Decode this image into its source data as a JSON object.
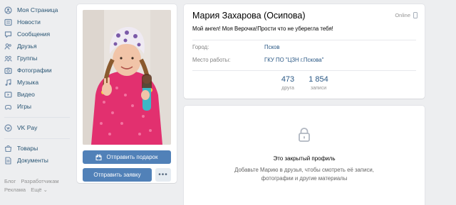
{
  "nav": {
    "items": [
      {
        "label": "Моя Страница",
        "icon": "home-icon"
      },
      {
        "label": "Новости",
        "icon": "news-icon"
      },
      {
        "label": "Сообщения",
        "icon": "messages-icon"
      },
      {
        "label": "Друзья",
        "icon": "friends-icon"
      },
      {
        "label": "Группы",
        "icon": "groups-icon"
      },
      {
        "label": "Фотографии",
        "icon": "photos-icon"
      },
      {
        "label": "Музыка",
        "icon": "music-icon"
      },
      {
        "label": "Видео",
        "icon": "video-icon"
      },
      {
        "label": "Игры",
        "icon": "games-icon"
      },
      {
        "label": "VK Pay",
        "icon": "vkpay-icon"
      },
      {
        "label": "Товары",
        "icon": "goods-icon"
      },
      {
        "label": "Документы",
        "icon": "documents-icon"
      }
    ],
    "footer": {
      "blog": "Блог",
      "developers": "Разработчикам",
      "ads": "Реклама",
      "more": "Ещё ⌄"
    }
  },
  "photo_card": {
    "gift_button": "Отправить подарок",
    "request_button": "Отправить заявку",
    "more_button": "•••"
  },
  "profile": {
    "name": "Мария Захарова (Осипова)",
    "online": "Online",
    "status": "Мой ангел! Моя Верочка!Прости что не уберегла тебя!",
    "rows": [
      {
        "label": "Город:",
        "value": "Псков"
      },
      {
        "label": "Место работы:",
        "value": "ГКУ ПО \"ЦЗН г.Пскова\""
      }
    ],
    "counters": [
      {
        "num": "473",
        "label": "друга"
      },
      {
        "num": "1 854",
        "label": "записи"
      }
    ]
  },
  "closed": {
    "title": "Это закрытый профиль",
    "desc_line1": "Добавьте Марию в друзья, чтобы смотреть её записи,",
    "desc_line2": "фотографии и другие материалы"
  },
  "colors": {
    "background": "#edeef0",
    "accent": "#5181b8",
    "link": "#2a5885"
  }
}
